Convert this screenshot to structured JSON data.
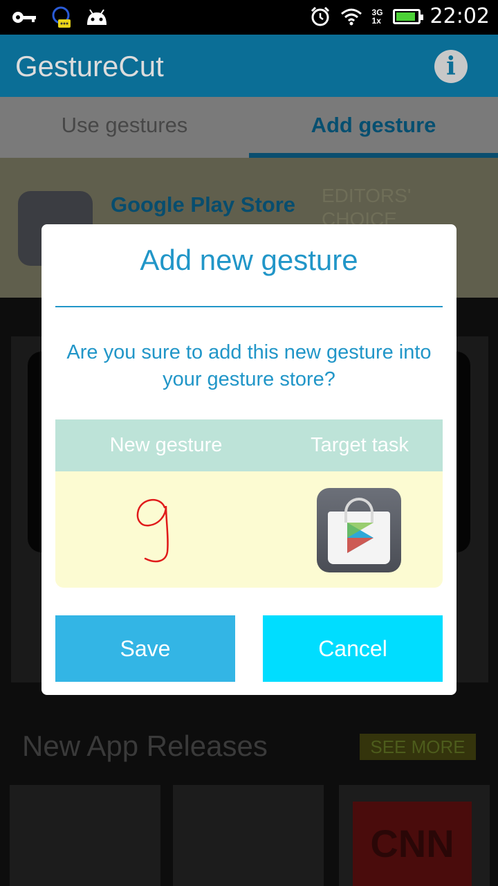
{
  "status_bar": {
    "time": "22:02",
    "network": "3G",
    "network_secondary": "1x",
    "icons": [
      "key-icon",
      "chat-icon",
      "android-icon",
      "alarm-icon",
      "wifi-icon",
      "signal-icon",
      "battery-icon"
    ]
  },
  "app": {
    "title": "GestureCut"
  },
  "tabs": [
    {
      "label": "Use gestures",
      "active": false
    },
    {
      "label": "Add gesture",
      "active": true
    }
  ],
  "background": {
    "store_name": "Google Play Store",
    "editors_choice": "EDITORS' CHOICE",
    "section_title": "New App Releases",
    "see_more": "SEE MORE"
  },
  "dialog": {
    "title": "Add new gesture",
    "message": "Are you sure to add this new gesture into your gesture store?",
    "col_gesture": "New gesture",
    "col_task": "Target task",
    "gesture_stroke_color": "#e01b1b",
    "task_icon": "google-play-store-icon",
    "save_label": "Save",
    "cancel_label": "Cancel"
  },
  "colors": {
    "accent": "#2196c8",
    "save": "#33b5e5",
    "cancel": "#00ddff",
    "appbar": "#0b6e96"
  }
}
